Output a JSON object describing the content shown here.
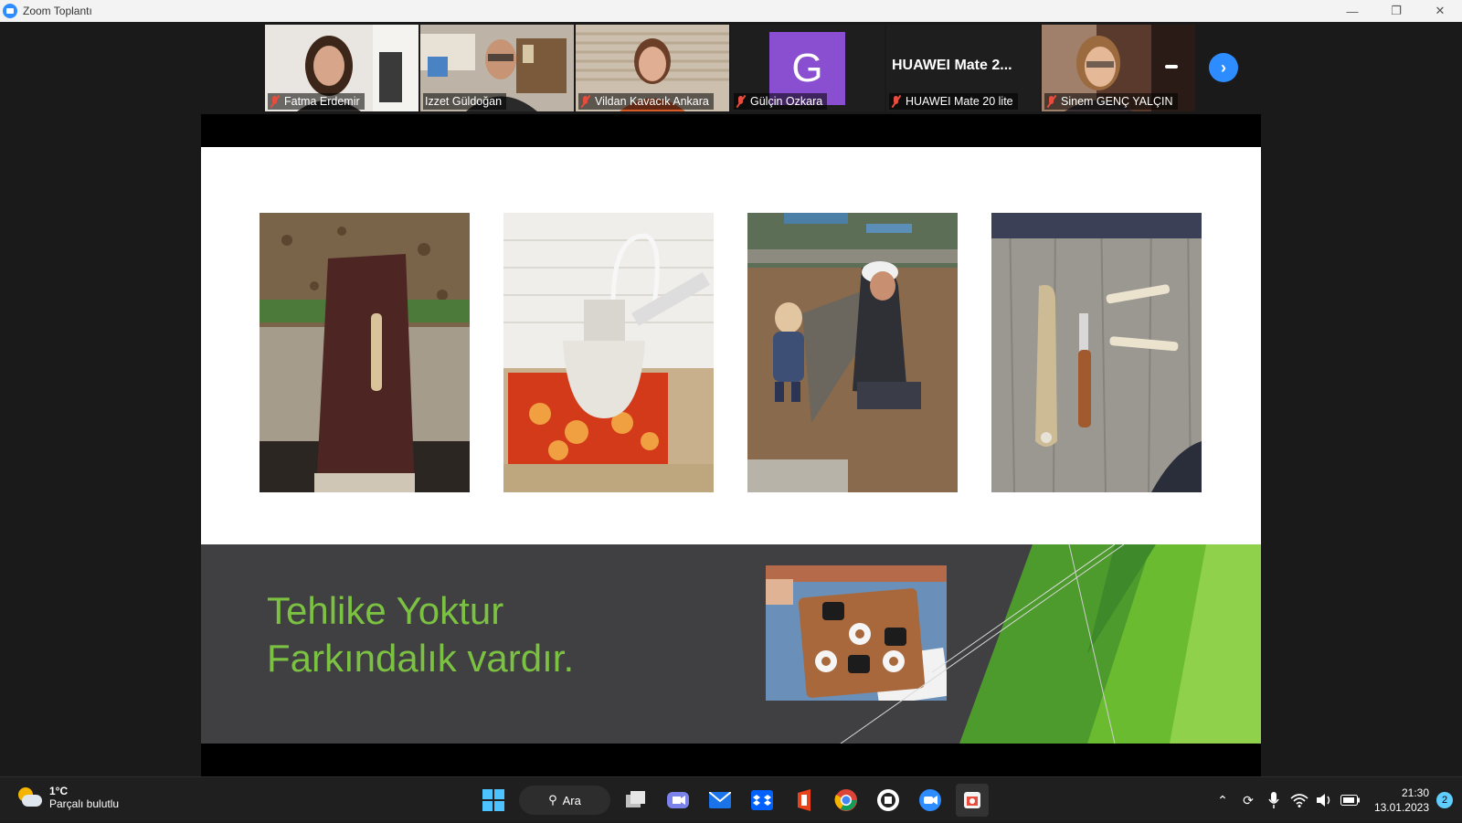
{
  "window": {
    "title": "Zoom Toplantı"
  },
  "participants": [
    {
      "name": "Fatma Erdemir",
      "muted": true,
      "video": true
    },
    {
      "name": "Izzet Güldoğan",
      "muted": false,
      "video": true,
      "active_speaker": true
    },
    {
      "name": "Vildan Kavacık Ankara",
      "muted": true,
      "video": true
    },
    {
      "name": "Gülçin Ozkara",
      "muted": true,
      "video": false,
      "avatar_letter": "G"
    },
    {
      "name": "HUAWEI Mate 20 lite",
      "muted": true,
      "video": false,
      "display_name": "HUAWEI Mate 2..."
    },
    {
      "name": "Sinem GENÇ YALÇIN",
      "muted": true,
      "video": true
    }
  ],
  "slide": {
    "slogan_line1": "Tehlike Yoktur",
    "slogan_line2": "Farkındalık vardır.",
    "accent_color": "#7cc242"
  },
  "taskbar": {
    "weather_temp": "1°C",
    "weather_desc": "Parçalı bulutlu",
    "search_label": "Ara",
    "time": "21:30",
    "date": "13.01.2023",
    "notification_count": "2"
  }
}
